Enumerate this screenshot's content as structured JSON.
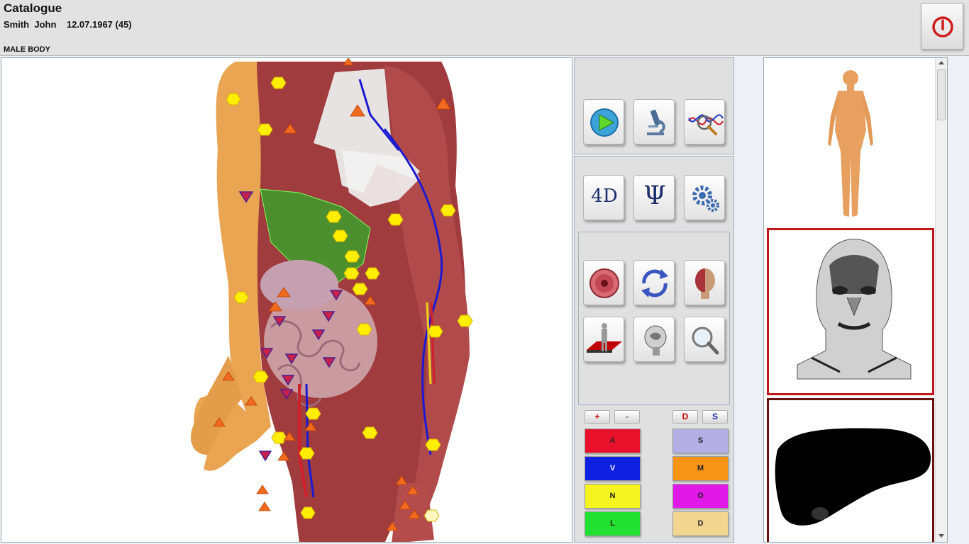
{
  "app": {
    "title": "Catalogue",
    "patient_info": "Smith  John    12.07.1967 (45)",
    "body_label": "MALE BODY"
  },
  "header": {
    "power_icon": "power-icon"
  },
  "toolbar_top": [
    {
      "name": "play-button",
      "icon": "play-icon"
    },
    {
      "name": "microscope-button",
      "icon": "microscope-icon"
    },
    {
      "name": "wave-analysis-button",
      "icon": "magnifier-wave-icon"
    }
  ],
  "toolbar_mid": [
    {
      "name": "4d-button",
      "label": "4D"
    },
    {
      "name": "psi-button",
      "label": "Ψ"
    },
    {
      "name": "settings-button",
      "icon": "gears-icon"
    }
  ],
  "toolbar_lower": [
    {
      "name": "cell-button",
      "icon": "cell-icon"
    },
    {
      "name": "rotate-button",
      "icon": "rotate-icon"
    },
    {
      "name": "head-anatomy-button",
      "icon": "head-icon"
    },
    {
      "name": "body-plane-button",
      "icon": "body-plane-icon"
    },
    {
      "name": "skull-section-button",
      "icon": "skull-icon"
    },
    {
      "name": "zoom-button",
      "icon": "magnifier-icon"
    }
  ],
  "small_buttons": {
    "plus": "+",
    "minus": "-",
    "d": "D",
    "s": "S"
  },
  "color_buttons": {
    "left": [
      {
        "label": "A",
        "color": "#e8102a"
      },
      {
        "label": "V",
        "color": "#1020e0"
      },
      {
        "label": "N",
        "color": "#f6f420"
      },
      {
        "label": "L",
        "color": "#22e030"
      }
    ],
    "right": [
      {
        "label": "S",
        "color": "#b4b0e6"
      },
      {
        "label": "M",
        "color": "#f79416"
      },
      {
        "label": "O",
        "color": "#e018e8"
      },
      {
        "label": "D",
        "color": "#f2d690"
      }
    ]
  },
  "thumbnails": [
    {
      "name": "full-body-thumbnail",
      "selected": false
    },
    {
      "name": "head-muscles-thumbnail",
      "selected": true
    },
    {
      "name": "liver-thumbnail",
      "selected": false
    }
  ]
}
